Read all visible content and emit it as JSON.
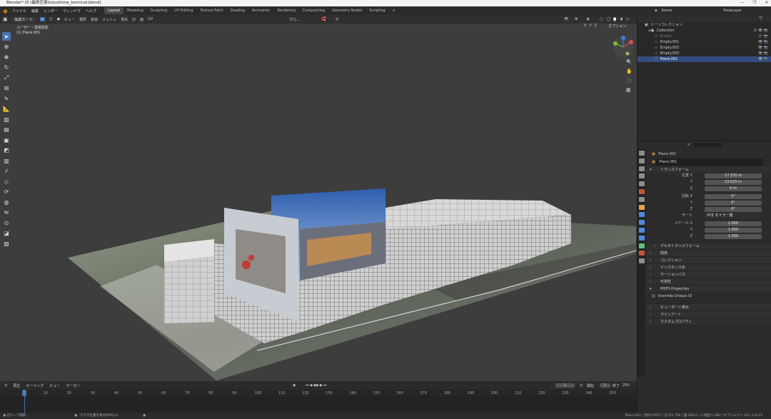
{
  "window": {
    "title": "Blender* [E:\\福島空港\\fukushima_terminal.blend]",
    "controls": [
      "—",
      "❐",
      "✕"
    ]
  },
  "menu": [
    "ファイル",
    "編集",
    "レンダー",
    "ウィンドウ",
    "ヘルプ"
  ],
  "workspaces": [
    "Layout",
    "Modeling",
    "Sculpting",
    "UV Editing",
    "Texture Paint",
    "Shading",
    "Animation",
    "Rendering",
    "Compositing",
    "Geometry Nodes",
    "Scripting",
    "+"
  ],
  "active_workspace": "Layout",
  "scene": {
    "label": "Scene",
    "view_layer": "ViewLayer"
  },
  "viewport": {
    "mode": "編集モード",
    "menus": [
      "ビュー",
      "選択",
      "追加",
      "メッシュ",
      "頂点",
      "辺",
      "面",
      "UV"
    ],
    "overlay_label": "ユーザー・透視投影",
    "object_label": "(1) Plane.001",
    "transform_orientation": "グロ...",
    "options_label": "オプション",
    "axes": {
      "x": "X",
      "y": "Y",
      "z": "Z"
    },
    "toolbar_icons": [
      "select-icon",
      "cursor-icon",
      "move-icon",
      "rotate-icon",
      "scale-icon",
      "transform-icon",
      "annotate-icon",
      "measure-icon",
      "add-cube-icon",
      "extrude-icon",
      "inset-icon",
      "bevel-icon",
      "loopcut-icon",
      "knife-icon",
      "polybuild-icon",
      "spin-icon",
      "smooth-icon",
      "edge-slide-icon",
      "shrink-icon",
      "shear-icon",
      "rip-icon"
    ]
  },
  "outliner": {
    "root": "シーンコレクション",
    "items": [
      {
        "name": "Collection",
        "indent": 1
      },
      {
        "name": "Empty",
        "indent": 2,
        "dim": true
      },
      {
        "name": "Empty.001",
        "indent": 2
      },
      {
        "name": "Empty.002",
        "indent": 2
      },
      {
        "name": "Empty.003",
        "indent": 2
      },
      {
        "name": "Plane.001",
        "indent": 2,
        "selected": true
      }
    ]
  },
  "properties": {
    "object_name": "Plane.001",
    "object_field": "Plane.001",
    "transform_header": "トランスフォーム",
    "location": {
      "label_x": "位置 X",
      "x": "17.131 m",
      "y": "23.625 m",
      "z": "0 m"
    },
    "rotation": {
      "label_x": "回転 X",
      "x": "0°",
      "y": "0°",
      "z": "0°"
    },
    "mode": {
      "label": "モード",
      "value": "XYZ オイラー角"
    },
    "scale": {
      "label_x": "スケール X",
      "x": "1.000",
      "y": "1.000",
      "z": "1.000"
    },
    "axis_labels": {
      "y": "Y",
      "z": "Z"
    },
    "panels": [
      "デルタトランスフォーム",
      "関係",
      "コレクション",
      "インスタンス化",
      "モーションパス",
      "可視性"
    ],
    "msfs_header": "MSFS Properties",
    "msfs_override": "Override Unique ID",
    "panels2": [
      "ビューポート表示",
      "ラインアート",
      "カスタムプロパティ"
    ]
  },
  "timeline": {
    "menus": [
      "再生",
      "キーイング",
      "ビュー",
      "マーカー"
    ],
    "current_frame": "1",
    "start_label": "開始",
    "start": "1",
    "end_label": "終了",
    "end": "250",
    "ticks": [
      "1",
      "10",
      "20",
      "30",
      "40",
      "50",
      "60",
      "70",
      "80",
      "90",
      "100",
      "110",
      "120",
      "130",
      "140",
      "150",
      "160",
      "170",
      "180",
      "190",
      "200",
      "210",
      "220",
      "230",
      "240",
      "250"
    ]
  },
  "status": {
    "left": "辺ループ選択",
    "middle": "マウス位置を視点の中心に",
    "right": "Plane.001 | 頂点:0/917 | 辺:0/1,756 | 面:0/812 | 三角面:1,680 | オブジェクト:1/4 | 3.6.23"
  }
}
